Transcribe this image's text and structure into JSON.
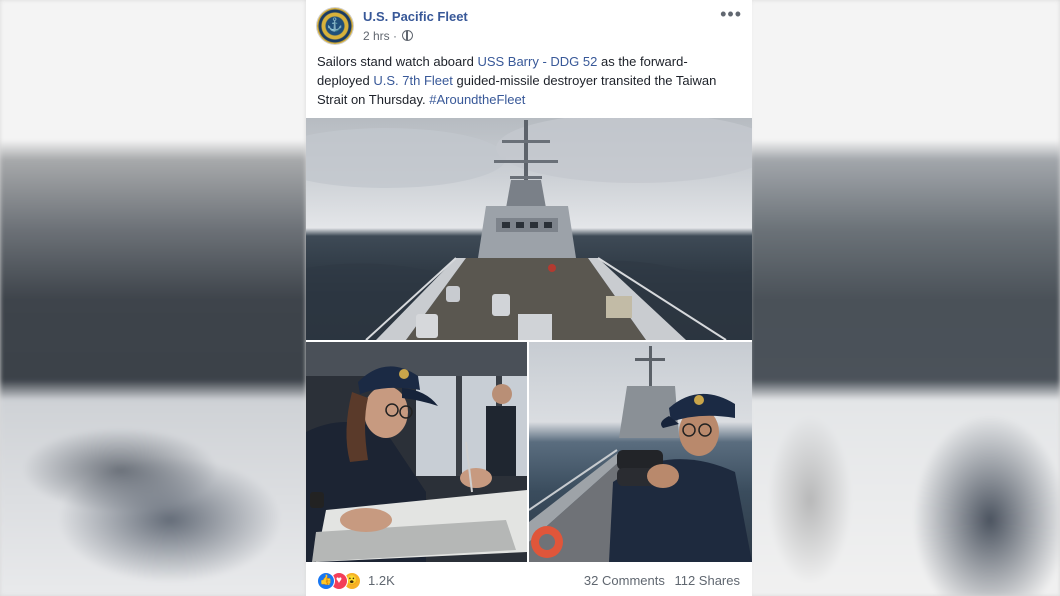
{
  "post": {
    "page_name": "U.S. Pacific Fleet",
    "avatar_text": "⚓",
    "time": "2 hrs",
    "time_separator": "·",
    "more_label": "•••",
    "text_part1": "Sailors stand watch aboard ",
    "link1": "USS Barry - DDG 52",
    "text_part2": " as the forward-deployed ",
    "link2": "U.S. 7th Fleet",
    "text_part3": " guided-missile destroyer transited the Taiwan Strait on Thursday. ",
    "hashtag": "#AroundtheFleet"
  },
  "photos": [
    {
      "id": "destroyer-bow"
    },
    {
      "id": "sailor-charting"
    },
    {
      "id": "sailor-binoculars"
    }
  ],
  "footer": {
    "reactions": [
      "like-icon",
      "love-icon",
      "wow-icon"
    ],
    "reaction_count": "1.2K",
    "comments": "32 Comments",
    "shares": "112 Shares"
  },
  "colors": {
    "link": "#385898",
    "like": "#1877f2",
    "love": "#f33e58",
    "wow": "#f7b125"
  }
}
